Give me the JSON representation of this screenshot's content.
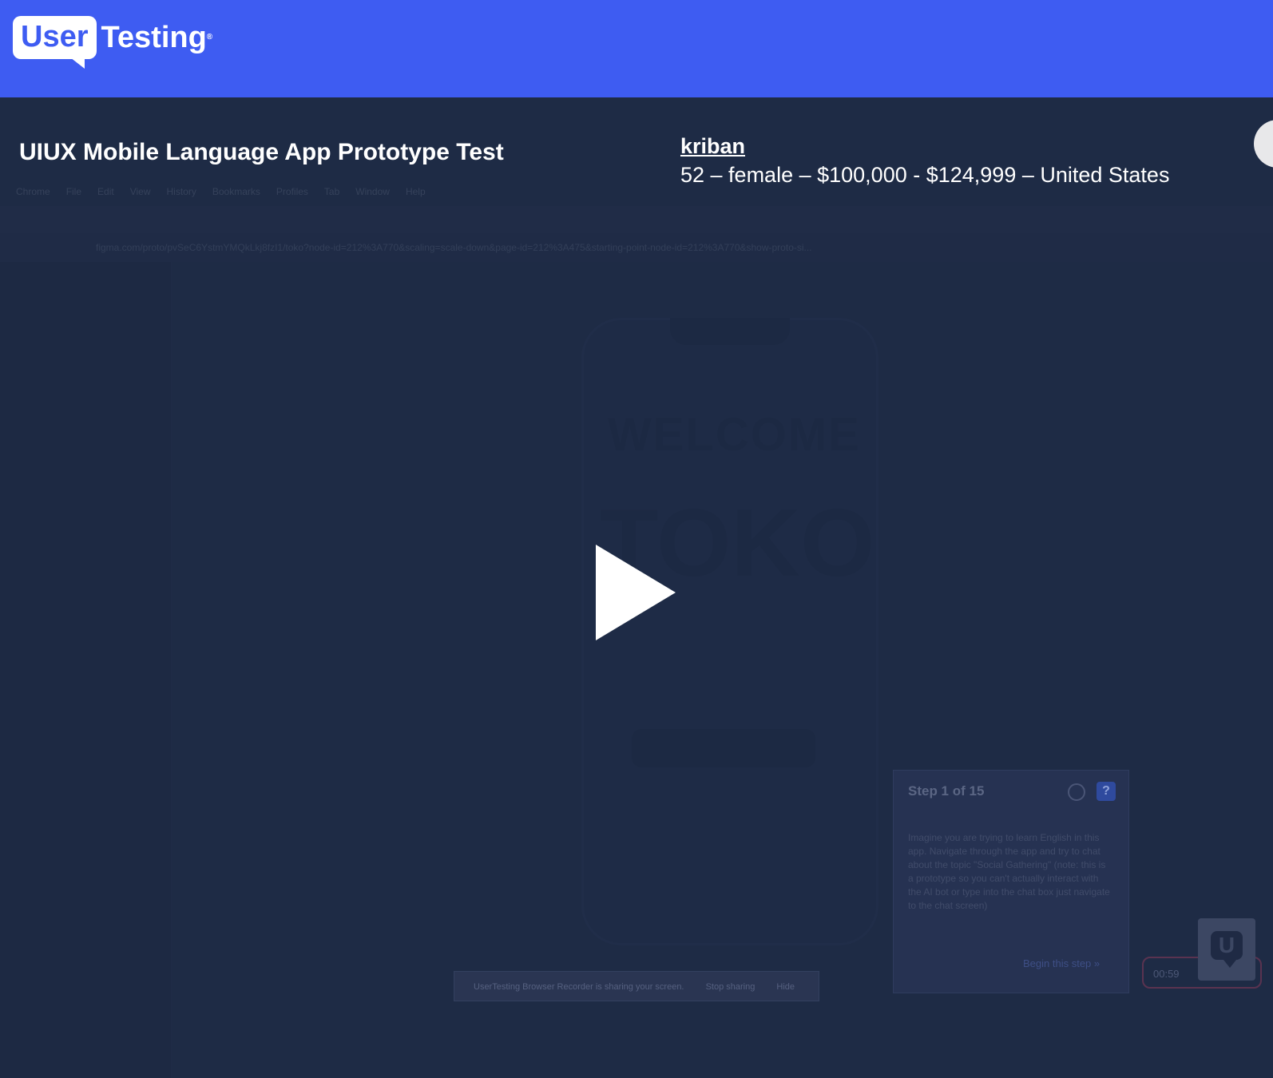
{
  "header": {
    "logo_user": "User",
    "logo_testing": "Testing",
    "logo_reg": "®"
  },
  "test": {
    "title": "UIUX Mobile Language App Prototype Test",
    "participant_name": "kriban",
    "participant_demographics": "52 – female – $100,000 - $124,999 – United States"
  },
  "recording": {
    "menu_items": [
      "Chrome",
      "File",
      "Edit",
      "View",
      "History",
      "Bookmarks",
      "Profiles",
      "Tab",
      "Window",
      "Help"
    ],
    "address_bar": "figma.com/proto/pvSeC6YstmYMQkLkj8fzI1/toko?node-id=212%3A770&scaling=scale-down&page-id=212%3A475&starting-point-node-id=212%3A770&show-proto-si...",
    "phone_heading": "WELCOME",
    "phone_heading2": "TO",
    "phone_brand": "TOKO",
    "step_title": "Step 1 of 15",
    "step_help": "?",
    "step_text": "Imagine you are trying to learn English in this app. Navigate through the app and try to chat about the topic \"Social Gathering\" (note: this is a prototype so you can't actually interact with the AI bot or type into the chat box just navigate to the chat screen)",
    "step_begin": "Begin this step »",
    "recorder_notice": "UserTesting Browser Recorder is sharing your screen.",
    "recorder_stop": "Stop sharing",
    "recorder_hide": "Hide",
    "timer": "00:59"
  },
  "colors": {
    "brand_blue": "#3e5cf2",
    "player_bg": "#1e2b45",
    "text": "#ffffff"
  },
  "icons": {
    "play": "play-icon",
    "help": "question-icon",
    "pause": "pause-icon",
    "ut_badge": "usertesting-u-icon"
  }
}
